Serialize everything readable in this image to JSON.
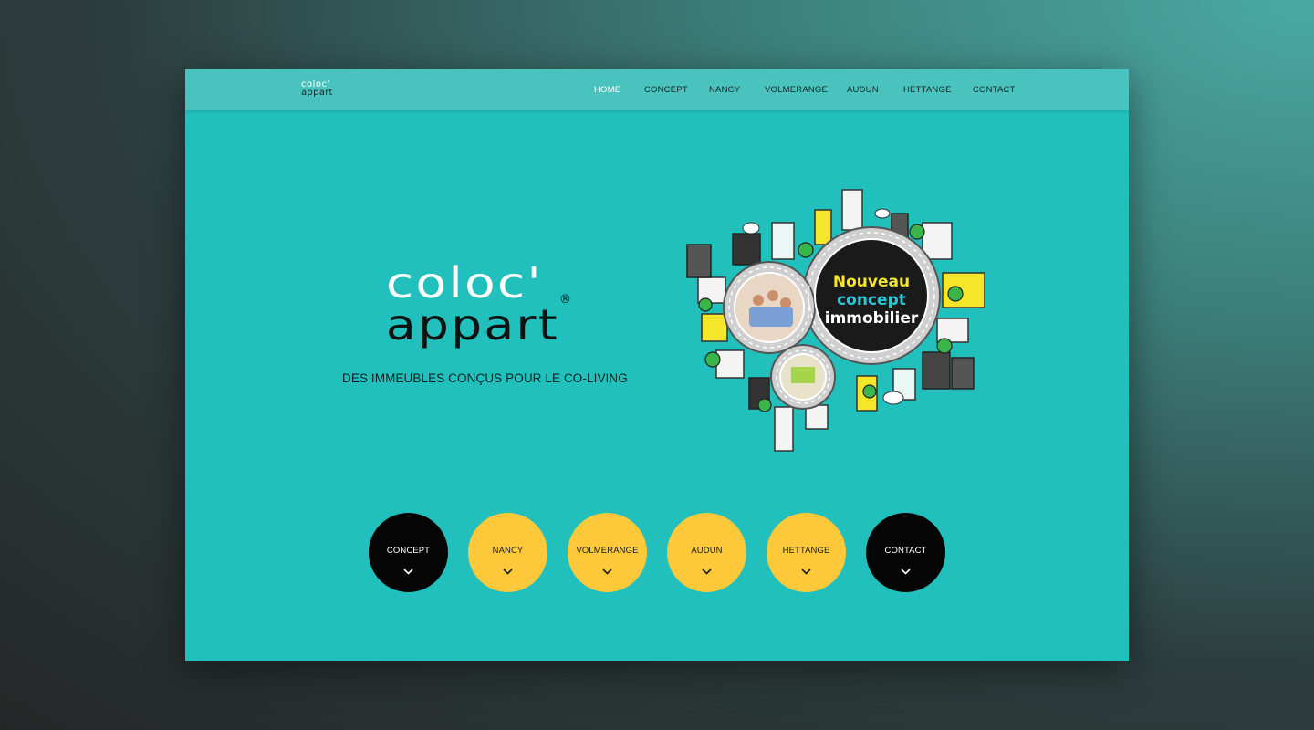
{
  "brand": {
    "line1": "coloc'",
    "line2": "appart",
    "registered": "®"
  },
  "nav": {
    "items": [
      {
        "label": "HOME",
        "active": true
      },
      {
        "label": "CONCEPT",
        "active": false
      },
      {
        "label": "NANCY",
        "active": false
      },
      {
        "label": "VOLMERANGE",
        "active": false
      },
      {
        "label": "AUDUN",
        "active": false
      },
      {
        "label": "HETTANGE",
        "active": false
      },
      {
        "label": "CONTACT",
        "active": false
      }
    ]
  },
  "hero": {
    "tagline": "DES IMMEUBLES CONÇUS POUR LE CO-LIVING",
    "badge": {
      "line1": "Nouveau",
      "line2": "concept",
      "line3": "immobilier"
    }
  },
  "circles": [
    {
      "label": "CONCEPT",
      "style": "dark",
      "icon": "chevron-down-icon"
    },
    {
      "label": "NANCY",
      "style": "yellow",
      "icon": "chevron-down-icon"
    },
    {
      "label": "VOLMERANGE",
      "style": "yellow",
      "icon": "chevron-down-icon"
    },
    {
      "label": "AUDUN",
      "style": "yellow",
      "icon": "chevron-down-icon"
    },
    {
      "label": "HETTANGE",
      "style": "yellow",
      "icon": "chevron-down-icon"
    },
    {
      "label": "CONTACT",
      "style": "dark",
      "icon": "chevron-down-icon"
    }
  ],
  "colors": {
    "page_bg": "#21c0bc",
    "navbar_bg": "#4ac3bf",
    "yellow": "#fdc93a",
    "dark": "#050505",
    "badge_yellow": "#f5e62a",
    "badge_cyan": "#27c8d6"
  }
}
